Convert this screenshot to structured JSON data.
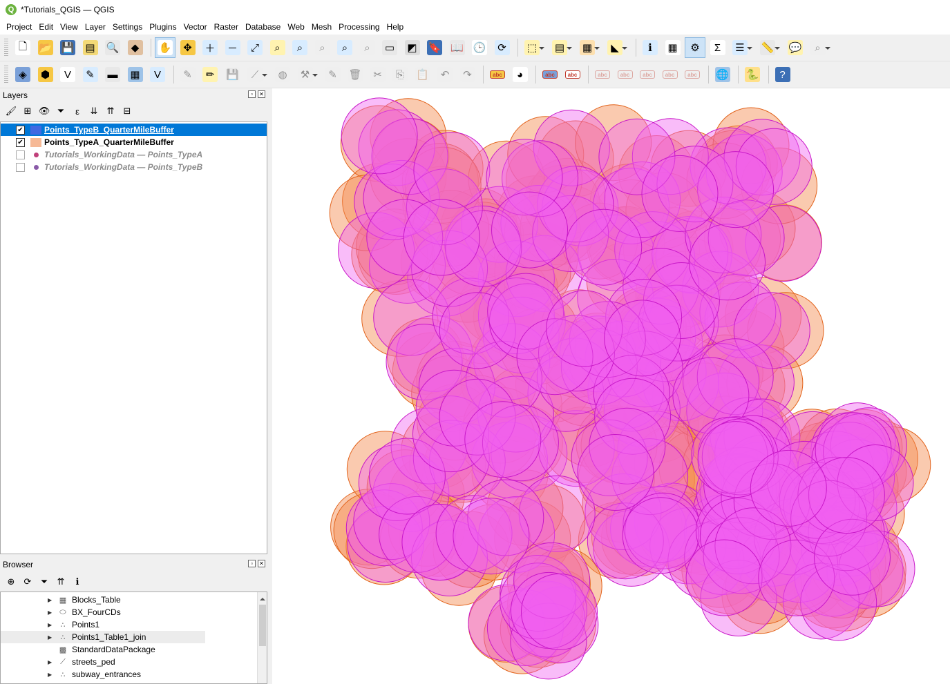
{
  "window": {
    "title": "*Tutorials_QGIS — QGIS"
  },
  "menu": [
    "Project",
    "Edit",
    "View",
    "Layer",
    "Settings",
    "Plugins",
    "Vector",
    "Raster",
    "Database",
    "Web",
    "Mesh",
    "Processing",
    "Help"
  ],
  "toolbar1": [
    {
      "name": "new-project-icon",
      "glyph": "🗋",
      "bg": "#ffffff"
    },
    {
      "name": "open-project-icon",
      "glyph": "📂",
      "bg": "#f6c744"
    },
    {
      "name": "save-project-icon",
      "glyph": "💾",
      "bg": "#3c6fb5"
    },
    {
      "name": "new-print-layout-icon",
      "glyph": "▤",
      "bg": "#f3d977"
    },
    {
      "name": "layout-manager-icon",
      "glyph": "🔍",
      "bg": "#e8e8e8"
    },
    {
      "name": "style-manager-icon",
      "glyph": "◆",
      "bg": "#e0c0a0"
    },
    {
      "name": "sep"
    },
    {
      "name": "pan-map-icon",
      "glyph": "✋",
      "bg": "#ffffff",
      "active": true
    },
    {
      "name": "pan-to-selection-icon",
      "glyph": "✥",
      "bg": "#f6c744"
    },
    {
      "name": "zoom-in-icon",
      "glyph": "＋",
      "bg": "#d8ecff"
    },
    {
      "name": "zoom-out-icon",
      "glyph": "－",
      "bg": "#d8ecff"
    },
    {
      "name": "zoom-full-icon",
      "glyph": "⤢",
      "bg": "#d8ecff"
    },
    {
      "name": "zoom-to-selection-icon",
      "glyph": "⌕",
      "bg": "#fff3b0"
    },
    {
      "name": "zoom-to-layer-icon",
      "glyph": "⌕",
      "bg": "#d8ecff"
    },
    {
      "name": "zoom-native-icon",
      "glyph": "⌕",
      "bg": "#eeeeee",
      "dim": true
    },
    {
      "name": "zoom-last-icon",
      "glyph": "⌕",
      "bg": "#d8ecff"
    },
    {
      "name": "zoom-next-icon",
      "glyph": "⌕",
      "bg": "#eeeeee",
      "dim": true
    },
    {
      "name": "new-map-view-icon",
      "glyph": "▭",
      "bg": "#e8e8e8"
    },
    {
      "name": "new-3d-view-icon",
      "glyph": "◩",
      "bg": "#dddddd"
    },
    {
      "name": "new-bookmark-icon",
      "glyph": "🔖",
      "bg": "#3c6fb5"
    },
    {
      "name": "show-bookmarks-icon",
      "glyph": "📖",
      "bg": "#e8e8e8"
    },
    {
      "name": "temporal-controller-icon",
      "glyph": "🕒",
      "bg": "#ffffff"
    },
    {
      "name": "refresh-icon",
      "glyph": "⟳",
      "bg": "#d8ecff"
    },
    {
      "name": "sep"
    },
    {
      "name": "select-features-icon",
      "glyph": "⬚",
      "bg": "#fff3b0",
      "dd": true
    },
    {
      "name": "select-by-value-icon",
      "glyph": "▤",
      "bg": "#fff3b0",
      "dd": true
    },
    {
      "name": "deselect-all-icon",
      "glyph": "▦",
      "bg": "#fde0b0",
      "dd": true
    },
    {
      "name": "select-by-location-icon",
      "glyph": "◣",
      "bg": "#fff3b0",
      "dd": true
    },
    {
      "name": "sep"
    },
    {
      "name": "identify-features-icon",
      "glyph": "ℹ",
      "bg": "#d8ecff"
    },
    {
      "name": "open-attribute-table-icon",
      "glyph": "▦",
      "bg": "#ffffff"
    },
    {
      "name": "processing-toolbox-icon",
      "glyph": "⚙",
      "bg": "#cde3f7",
      "active": true
    },
    {
      "name": "statistical-summary-icon",
      "glyph": "Σ",
      "bg": "#ffffff"
    },
    {
      "name": "attribute-table-icon",
      "glyph": "☰",
      "bg": "#d8ecff",
      "dd": true
    },
    {
      "name": "measure-line-icon",
      "glyph": "📏",
      "bg": "#e8e8e8",
      "dd": true
    },
    {
      "name": "map-tips-icon",
      "glyph": "💬",
      "bg": "#fff3b0"
    },
    {
      "name": "locator-icon",
      "glyph": "⌕",
      "bg": "#eeeeee",
      "dim": true,
      "dd": true
    }
  ],
  "toolbar2": [
    {
      "name": "data-source-manager-icon",
      "glyph": "◈",
      "bg": "#7aa0d8"
    },
    {
      "name": "new-geopackage-layer-icon",
      "glyph": "⬢",
      "bg": "#f6c744"
    },
    {
      "name": "new-shapefile-layer-icon",
      "glyph": "V",
      "bg": "#ffffff"
    },
    {
      "name": "new-spatialite-layer-icon",
      "glyph": "✎",
      "bg": "#d8ecff"
    },
    {
      "name": "new-virtual-layer-icon",
      "glyph": "▬",
      "bg": "#e8e8e8"
    },
    {
      "name": "add-raster-layer-icon",
      "glyph": "▦",
      "bg": "#9ec3e8"
    },
    {
      "name": "add-vector-layer-icon",
      "glyph": "V",
      "bg": "#d8ecff"
    },
    {
      "name": "sep"
    },
    {
      "name": "current-edits-icon",
      "glyph": "✎",
      "bg": "#eeeeee",
      "dim": true
    },
    {
      "name": "toggle-editing-icon",
      "glyph": "✏",
      "bg": "#fff3b0"
    },
    {
      "name": "save-layer-edits-icon",
      "glyph": "💾",
      "bg": "#eeeeee",
      "dim": true
    },
    {
      "name": "digitize-line-icon",
      "glyph": "⟋",
      "bg": "#eeeeee",
      "dim": true,
      "dd": true
    },
    {
      "name": "add-feature-icon",
      "glyph": "◍",
      "bg": "#eeeeee",
      "dim": true
    },
    {
      "name": "vertex-tool-icon",
      "glyph": "⚒",
      "bg": "#eeeeee",
      "dim": true,
      "dd": true
    },
    {
      "name": "modify-attributes-icon",
      "glyph": "✎",
      "bg": "#eeeeee",
      "dim": true
    },
    {
      "name": "delete-selected-icon",
      "glyph": "🗑",
      "bg": "#eeeeee",
      "dim": true
    },
    {
      "name": "cut-features-icon",
      "glyph": "✂",
      "bg": "#eeeeee",
      "dim": true
    },
    {
      "name": "copy-features-icon",
      "glyph": "⎘",
      "bg": "#eeeeee",
      "dim": true
    },
    {
      "name": "paste-features-icon",
      "glyph": "📋",
      "bg": "#eeeeee",
      "dim": true
    },
    {
      "name": "undo-icon",
      "glyph": "↶",
      "bg": "#eeeeee",
      "dim": true
    },
    {
      "name": "redo-icon",
      "glyph": "↷",
      "bg": "#eeeeee",
      "dim": true
    },
    {
      "name": "sep"
    },
    {
      "name": "layer-labeling-icon",
      "glyph": "abc",
      "bg": "#f6c744",
      "small": true
    },
    {
      "name": "layer-diagram-icon",
      "glyph": "◕",
      "bg": "#ffffff"
    },
    {
      "name": "sep"
    },
    {
      "name": "highlight-pinned-labels-icon",
      "glyph": "abc",
      "bg": "#7aa0d8",
      "small": true
    },
    {
      "name": "pin-labels-icon",
      "glyph": "abc",
      "bg": "#ffffff",
      "small": true
    },
    {
      "name": "sep"
    },
    {
      "name": "show-hide-labels-icon",
      "glyph": "abc",
      "bg": "#eeeeee",
      "dim": true,
      "small": true
    },
    {
      "name": "move-label-icon",
      "glyph": "abc",
      "bg": "#eeeeee",
      "dim": true,
      "small": true
    },
    {
      "name": "rotate-label-icon",
      "glyph": "abc",
      "bg": "#eeeeee",
      "dim": true,
      "small": true
    },
    {
      "name": "change-label-icon",
      "glyph": "abc",
      "bg": "#eeeeee",
      "dim": true,
      "small": true
    },
    {
      "name": "label-properties-icon",
      "glyph": "abc",
      "bg": "#eeeeee",
      "dim": true,
      "small": true
    },
    {
      "name": "sep"
    },
    {
      "name": "georeferencer-icon",
      "glyph": "🌐",
      "bg": "#9ec3e8"
    },
    {
      "name": "sep"
    },
    {
      "name": "python-console-icon",
      "glyph": "🐍",
      "bg": "#ffe08a"
    },
    {
      "name": "sep"
    },
    {
      "name": "help-icon",
      "glyph": "?",
      "bg": "#3c6fb5",
      "fg": "#ffffff"
    }
  ],
  "layers_panel": {
    "title": "Layers",
    "tools": [
      {
        "name": "open-layer-styling-icon",
        "glyph": "🖌"
      },
      {
        "name": "add-group-icon",
        "glyph": "⊞"
      },
      {
        "name": "manage-map-themes-icon",
        "glyph": "👁"
      },
      {
        "name": "filter-legend-icon",
        "glyph": "⏷"
      },
      {
        "name": "filter-by-expression-icon",
        "glyph": "ε"
      },
      {
        "name": "expand-all-icon",
        "glyph": "⇊"
      },
      {
        "name": "collapse-all-icon",
        "glyph": "⇈"
      },
      {
        "name": "remove-layer-icon",
        "glyph": "⊟"
      }
    ],
    "layers": [
      {
        "label": "Points_TypeB_QuarterMileBuffer",
        "checked": true,
        "selected": true,
        "swatch": "#4169e1",
        "style": "bold"
      },
      {
        "label": "Points_TypeA_QuarterMileBuffer",
        "checked": true,
        "selected": false,
        "swatch": "#f6b996",
        "style": "bold"
      },
      {
        "label": "Tutorials_WorkingData — Points_TypeA",
        "checked": false,
        "selected": false,
        "dot": "#c0407a",
        "style": "italic"
      },
      {
        "label": "Tutorials_WorkingData — Points_TypeB",
        "checked": false,
        "selected": false,
        "dot": "#8a5aa8",
        "style": "italic"
      }
    ]
  },
  "browser_panel": {
    "title": "Browser",
    "tools": [
      {
        "name": "add-selected-layers-icon",
        "glyph": "⊕"
      },
      {
        "name": "refresh-browser-icon",
        "glyph": "⟳"
      },
      {
        "name": "filter-browser-icon",
        "glyph": "⏷"
      },
      {
        "name": "collapse-browser-icon",
        "glyph": "⇈"
      },
      {
        "name": "enable-properties-icon",
        "glyph": "ℹ"
      }
    ],
    "items": [
      {
        "label": "Blocks_Table",
        "icon": "table-icon",
        "glyph": "▦",
        "arrow": true
      },
      {
        "label": "BX_FourCDs",
        "icon": "polygon-layer-icon",
        "glyph": "⬭",
        "arrow": true
      },
      {
        "label": "Points1",
        "icon": "point-layer-icon",
        "glyph": "∴",
        "arrow": true
      },
      {
        "label": "Points1_Table1_join",
        "icon": "point-layer-icon",
        "glyph": "∴",
        "arrow": true,
        "hover": true
      },
      {
        "label": "StandardDataPackage",
        "icon": "raster-layer-icon",
        "glyph": "▩",
        "arrow": false
      },
      {
        "label": "streets_ped",
        "icon": "line-layer-icon",
        "glyph": "⟋",
        "arrow": true
      },
      {
        "label": "subway_entrances",
        "icon": "point-layer-icon",
        "glyph": "∴",
        "arrow": true
      }
    ]
  },
  "map": {
    "colors": {
      "typeA_fill": "#f58a4e",
      "typeA_stroke": "#e2621a",
      "typeB_fill": "#f060f0",
      "typeB_stroke": "#c818c8"
    }
  }
}
